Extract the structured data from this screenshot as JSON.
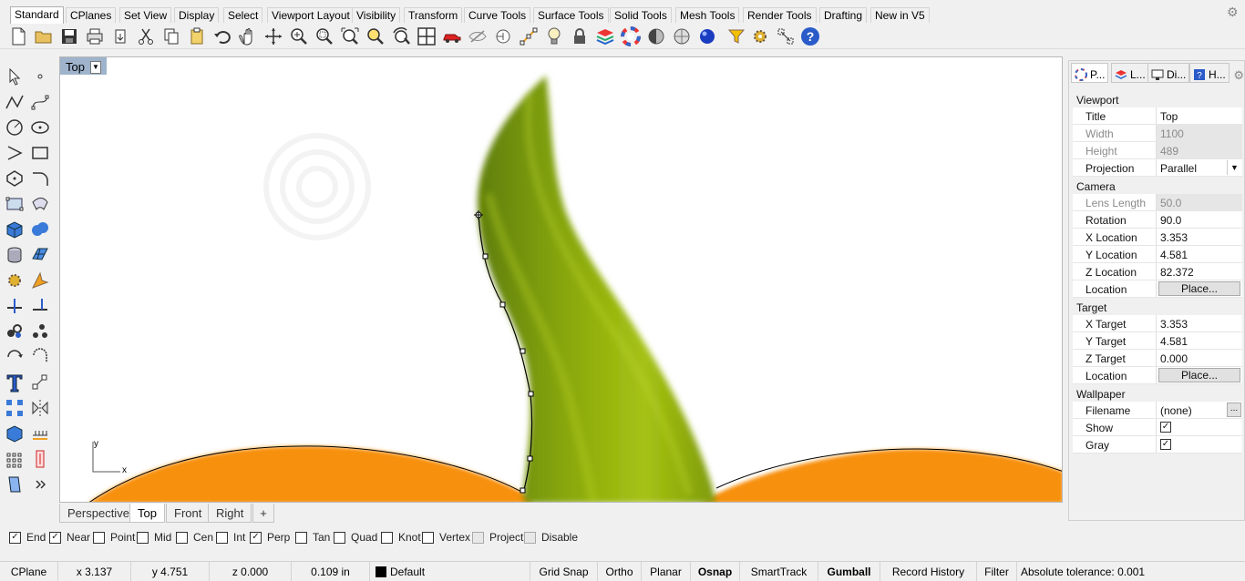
{
  "tabs": [
    "Standard",
    "CPlanes",
    "Set View",
    "Display",
    "Select",
    "Viewport Layout",
    "Visibility",
    "Transform",
    "Curve Tools",
    "Surface Tools",
    "Solid Tools",
    "Mesh Tools",
    "Render Tools",
    "Drafting",
    "New in V5"
  ],
  "active_tab": "Standard",
  "toolbar_icons": [
    "new-document-icon",
    "open-folder-icon",
    "save-icon",
    "print-icon",
    "import-icon",
    "cut-icon",
    "copy-icon",
    "paste-icon",
    "undo-icon",
    "pan-hand-icon",
    "rotate-view-icon",
    "zoom-icon",
    "zoom-window-icon",
    "zoom-extents-icon",
    "zoom-selected-icon",
    "undo-view-icon",
    "four-viewports-icon",
    "car-icon",
    "hide-icon",
    "show-icon",
    "points-on-icon",
    "light-bulb-icon",
    "lock-icon",
    "layers-icon",
    "color-wheel-icon",
    "render-sphere-icon",
    "material-sphere-icon",
    "blue-sphere-icon",
    "filter-icon",
    "settings-gears-icon",
    "grid-snap-icon",
    "help-icon"
  ],
  "viewport": {
    "label": "Top",
    "axis_x": "x",
    "axis_y": "y"
  },
  "viewport_tabs": [
    "Perspective",
    "Top",
    "Front",
    "Right"
  ],
  "active_viewport_tab": "Top",
  "osnaps": [
    {
      "label": "End",
      "checked": true,
      "disabled": false
    },
    {
      "label": "Near",
      "checked": true,
      "disabled": false
    },
    {
      "label": "Point",
      "checked": false,
      "disabled": false
    },
    {
      "label": "Mid",
      "checked": false,
      "disabled": false
    },
    {
      "label": "Cen",
      "checked": false,
      "disabled": false
    },
    {
      "label": "Int",
      "checked": false,
      "disabled": false
    },
    {
      "label": "Perp",
      "checked": true,
      "disabled": false
    },
    {
      "label": "Tan",
      "checked": false,
      "disabled": false
    },
    {
      "label": "Quad",
      "checked": false,
      "disabled": false
    },
    {
      "label": "Knot",
      "checked": false,
      "disabled": false
    },
    {
      "label": "Vertex",
      "checked": false,
      "disabled": false
    },
    {
      "label": "Project",
      "checked": false,
      "disabled": true
    },
    {
      "label": "Disable",
      "checked": false,
      "disabled": true
    }
  ],
  "statusbar": {
    "cplane": "CPlane",
    "x": "x 3.137",
    "y": "y 4.751",
    "z": "z 0.000",
    "units": "0.109 in",
    "layer": "Default",
    "grid_snap": "Grid Snap",
    "ortho": "Ortho",
    "planar": "Planar",
    "osnap": "Osnap",
    "smarttrack": "SmartTrack",
    "gumball": "Gumball",
    "record_history": "Record History",
    "filter": "Filter",
    "tolerance": "Absolute tolerance: 0.001"
  },
  "panel_tabs": [
    {
      "label": "P...",
      "icon": "properties-icon"
    },
    {
      "label": "L...",
      "icon": "layers-icon"
    },
    {
      "label": "Di...",
      "icon": "display-icon"
    },
    {
      "label": "H...",
      "icon": "help-icon"
    }
  ],
  "properties": {
    "viewport_section": "Viewport",
    "title_label": "Title",
    "title_value": "Top",
    "width_label": "Width",
    "width_value": "1100",
    "height_label": "Height",
    "height_value": "489",
    "projection_label": "Projection",
    "projection_value": "Parallel",
    "camera_section": "Camera",
    "lens_label": "Lens Length",
    "lens_value": "50.0",
    "rotation_label": "Rotation",
    "rotation_value": "90.0",
    "xloc_label": "X Location",
    "xloc_value": "3.353",
    "yloc_label": "Y Location",
    "yloc_value": "4.581",
    "zloc_label": "Z Location",
    "zloc_value": "82.372",
    "loc_label": "Location",
    "loc_button": "Place...",
    "target_section": "Target",
    "xtarget_label": "X Target",
    "xtarget_value": "3.353",
    "ytarget_label": "Y Target",
    "ytarget_value": "4.581",
    "ztarget_label": "Z Target",
    "ztarget_value": "0.000",
    "tloc_label": "Location",
    "tloc_button": "Place...",
    "wallpaper_section": "Wallpaper",
    "filename_label": "Filename",
    "filename_value": "(none)",
    "show_label": "Show",
    "show_checked": true,
    "gray_label": "Gray",
    "gray_checked": true,
    "more_button": "..."
  },
  "colors": {
    "leaf": "#8fae10",
    "leaf_dark": "#6f8e0a",
    "pumpkin": "#f7900c",
    "viewport_label_bg": "#9fb4cc"
  }
}
